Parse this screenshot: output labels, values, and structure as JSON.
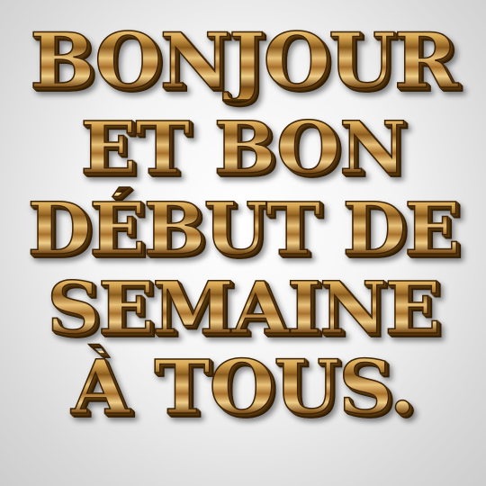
{
  "greeting": {
    "lines": [
      "BONJOUR",
      "ET BON",
      "DÉBUT DE",
      "SEMAINE",
      "À TOUS."
    ]
  },
  "colors": {
    "background": "#e6e6e6",
    "text_gold_light": "#f6dc9c",
    "text_gold_dark": "#8a5a1c",
    "outline": "#3b2206"
  }
}
